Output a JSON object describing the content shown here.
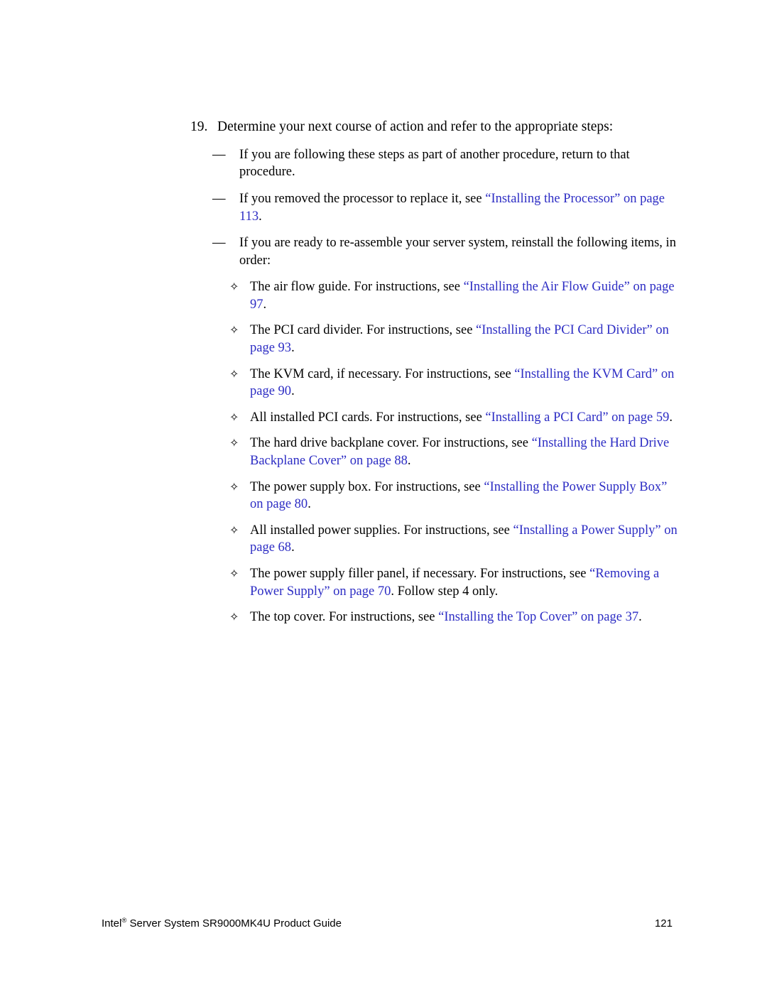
{
  "document": {
    "page_number": "121",
    "link_color": "#2d2dc4",
    "text_color": "#000000",
    "background_color": "#ffffff"
  },
  "step": {
    "number": "19.",
    "text": "Determine your next course of action and refer to the appropriate steps:"
  },
  "markers": {
    "dash": "—",
    "diamond": "✧"
  },
  "dash_items": [
    {
      "id": "return-to-procedure",
      "segments": [
        {
          "text": "If you are following these steps as part of another procedure, return to that procedure.",
          "style": "plain"
        }
      ]
    },
    {
      "id": "reinstall-processor",
      "segments": [
        {
          "text": "If you removed the processor to replace it, see ",
          "style": "plain"
        },
        {
          "text": "“Installing the Processor” on page 113",
          "style": "link"
        },
        {
          "text": ".",
          "style": "plain"
        }
      ]
    },
    {
      "id": "reassemble-server",
      "segments": [
        {
          "text": "If you are ready to re-assemble your server system, reinstall the following items, in order:",
          "style": "plain"
        }
      ]
    }
  ],
  "diamond_items": [
    {
      "id": "air-flow-guide",
      "segments": [
        {
          "text": "The air flow guide. For instructions, see ",
          "style": "plain"
        },
        {
          "text": "“Installing the Air Flow Guide” on page 97",
          "style": "link"
        },
        {
          "text": ".",
          "style": "plain"
        }
      ]
    },
    {
      "id": "pci-card-divider",
      "segments": [
        {
          "text": "The PCI card divider. For instructions, see ",
          "style": "plain"
        },
        {
          "text": "“Installing the PCI Card Divider” on page 93",
          "style": "link"
        },
        {
          "text": ".",
          "style": "plain"
        }
      ]
    },
    {
      "id": "kvm-card",
      "segments": [
        {
          "text": "The KVM card, if necessary. For instructions, see ",
          "style": "plain"
        },
        {
          "text": "“Installing the KVM Card” on page 90",
          "style": "link"
        },
        {
          "text": ".",
          "style": "plain"
        }
      ]
    },
    {
      "id": "pci-cards",
      "segments": [
        {
          "text": "All installed PCI cards. For instructions, see ",
          "style": "plain"
        },
        {
          "text": "“Installing a PCI Card” on page 59",
          "style": "link"
        },
        {
          "text": ".",
          "style": "plain"
        }
      ]
    },
    {
      "id": "hard-drive-backplane-cover",
      "segments": [
        {
          "text": "The hard drive backplane cover. For instructions, see ",
          "style": "plain"
        },
        {
          "text": "“Installing the Hard Drive Backplane Cover” on page 88",
          "style": "link"
        },
        {
          "text": ".",
          "style": "plain"
        }
      ]
    },
    {
      "id": "power-supply-box",
      "segments": [
        {
          "text": "The power supply box. For instructions, see ",
          "style": "plain"
        },
        {
          "text": "“Installing the Power Supply Box” on page 80",
          "style": "link"
        },
        {
          "text": ".",
          "style": "plain"
        }
      ]
    },
    {
      "id": "power-supplies",
      "segments": [
        {
          "text": "All installed power supplies. For instructions, see ",
          "style": "plain"
        },
        {
          "text": "“Installing a Power Supply” on page 68",
          "style": "link"
        },
        {
          "text": ".",
          "style": "plain"
        }
      ]
    },
    {
      "id": "power-supply-filler-panel",
      "segments": [
        {
          "text": "The power supply filler panel, if necessary. For instructions, see ",
          "style": "plain"
        },
        {
          "text": "“Removing a Power Supply” on page 70",
          "style": "link"
        },
        {
          "text": ". Follow step 4 only.",
          "style": "plain"
        }
      ]
    },
    {
      "id": "top-cover",
      "segments": [
        {
          "text": "The top cover. For instructions, see ",
          "style": "plain"
        },
        {
          "text": "“Installing the Top Cover” on page 37",
          "style": "link"
        },
        {
          "text": ".",
          "style": "plain"
        }
      ]
    }
  ],
  "footer": {
    "brand": "Intel",
    "registered_mark": "®",
    "title": " Server System SR9000MK4U Product Guide",
    "page_number": "121"
  }
}
